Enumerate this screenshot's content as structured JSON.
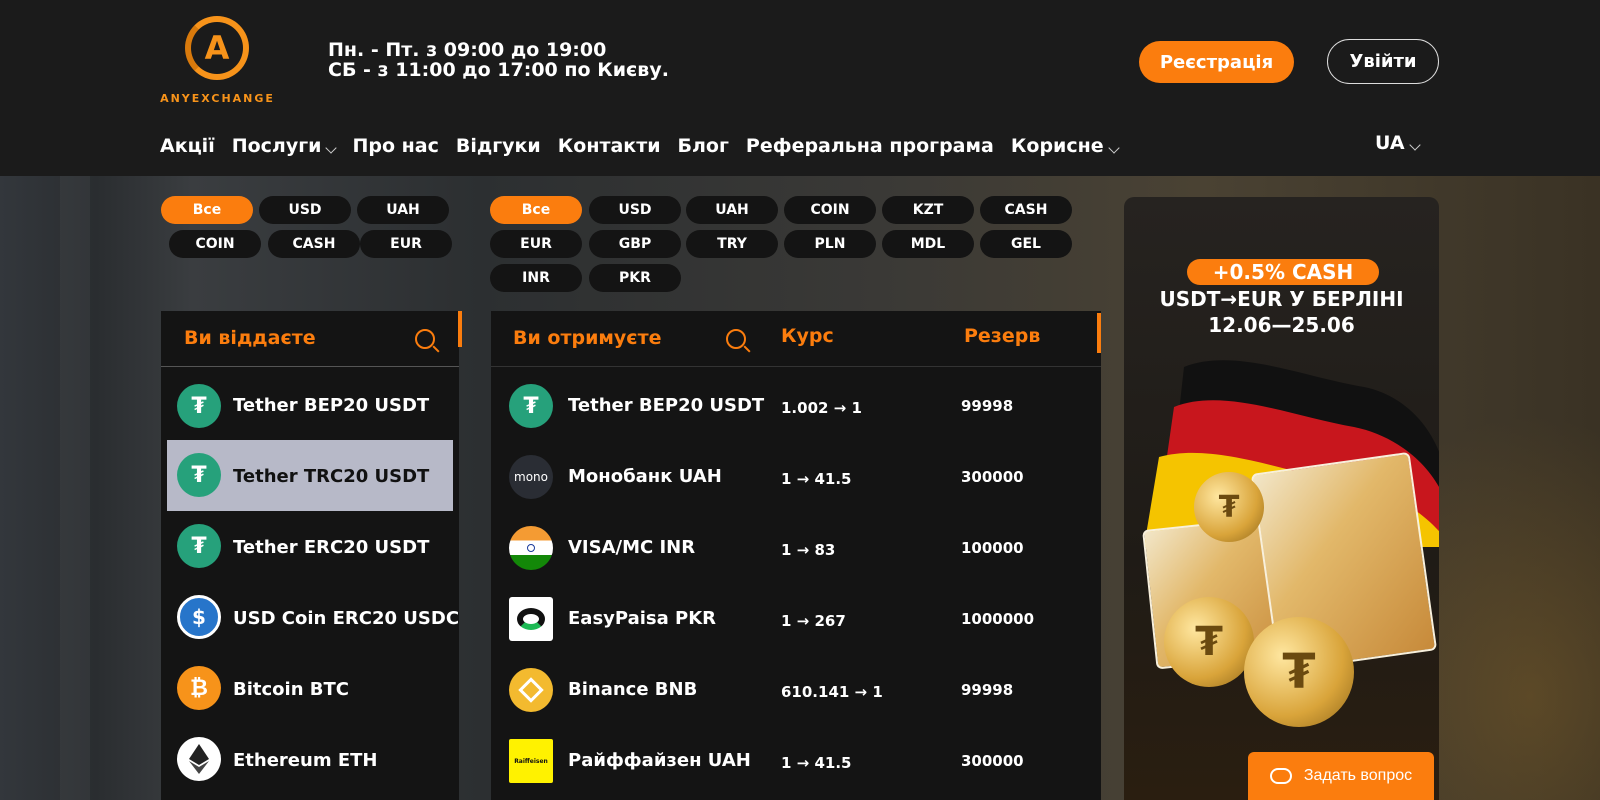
{
  "header": {
    "logo_text": "ANYEXCHANGE",
    "logo_letter": "A",
    "hours_line1": "Пн. - Пт. з 09:00 до 19:00",
    "hours_line2": "СБ - з 11:00 до 17:00 по Києву.",
    "register_label": "Реєстрація",
    "login_label": "Увійти"
  },
  "nav": {
    "items": [
      "Акції",
      "Послуги",
      "Про нас",
      "Відгуки",
      "Контакти",
      "Блог",
      "Реферальна програма",
      "Корисне"
    ],
    "language": "UA"
  },
  "give_filters": [
    "Все",
    "USD",
    "UAH",
    "COIN",
    "CASH",
    "EUR"
  ],
  "receive_filters": [
    "Все",
    "USD",
    "UAH",
    "COIN",
    "KZT",
    "CASH",
    "EUR",
    "GBP",
    "TRY",
    "PLN",
    "MDL",
    "GEL",
    "INR",
    "PKR"
  ],
  "give_panel": {
    "title": "Ви віддаєте",
    "items": [
      {
        "name": "Tether BEP20 USDT",
        "icon": "tether-icon"
      },
      {
        "name": "Tether TRC20 USDT",
        "icon": "tether-icon"
      },
      {
        "name": "Tether ERC20 USDT",
        "icon": "tether-icon"
      },
      {
        "name": "USD Coin ERC20 USDC",
        "icon": "usdc-icon"
      },
      {
        "name": "Bitcoin BTC",
        "icon": "bitcoin-icon"
      },
      {
        "name": "Ethereum ETH",
        "icon": "ethereum-icon"
      }
    ]
  },
  "receive_panel": {
    "title": "Ви отримуєте",
    "col_rate": "Курс",
    "col_reserve": "Резерв",
    "items": [
      {
        "name": "Tether BEP20 USDT",
        "rate": "1.002 → 1",
        "reserve": "99998",
        "icon": "tether-icon"
      },
      {
        "name": "Монобанк UAH",
        "rate": "1 → 41.5",
        "reserve": "300000",
        "icon": "monobank-icon",
        "icon_text": "mono"
      },
      {
        "name": "VISA/MC INR",
        "rate": "1 → 83",
        "reserve": "100000",
        "icon": "india-flag-icon"
      },
      {
        "name": "EasyPaisa PKR",
        "rate": "1 → 267",
        "reserve": "1000000",
        "icon": "easypaisa-icon"
      },
      {
        "name": "Binance BNB",
        "rate": "610.141 → 1",
        "reserve": "99998",
        "icon": "binance-icon"
      },
      {
        "name": "Райффайзен UAH",
        "rate": "1 → 41.5",
        "reserve": "300000",
        "icon": "raiffeisen-icon",
        "icon_text": "Raiffeisen"
      }
    ]
  },
  "promo": {
    "badge": "+0.5% CASH",
    "line1": "USDT→EUR У БЕРЛІНІ",
    "line2": "12.06—25.06"
  },
  "chat": {
    "label": "Задать вопрос"
  },
  "colors": {
    "accent": "#fb7d0e",
    "tether": "#26a17b",
    "usdc": "#2775ca",
    "bitcoin": "#f7931a",
    "binance": "#f3ba2f",
    "raiffeisen": "#fff200"
  }
}
